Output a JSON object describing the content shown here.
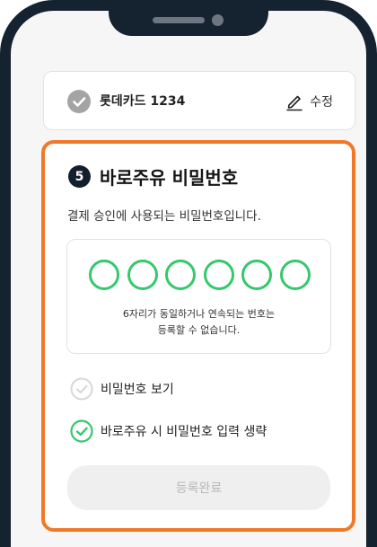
{
  "card": {
    "name": "롯데카드 1234",
    "edit_label": "수정"
  },
  "password_section": {
    "step_number": "5",
    "title": "바로주유 비밀번호",
    "description": "결제 승인에 사용되는 비밀번호입니다.",
    "pin_length": 6,
    "hint_line1": "6자리가 동일하거나 연속되는 번호는",
    "hint_line2": "등록할 수 없습니다.",
    "show_password": {
      "label": "비밀번호 보기",
      "checked": false
    },
    "skip_password": {
      "label": "바로주유 시 비밀번호 입력 생략",
      "checked": true
    },
    "submit_label": "등록완료"
  },
  "colors": {
    "accent_orange": "#f07826",
    "pin_green": "#35c86c",
    "frame_navy": "#152230"
  },
  "icons": {
    "card_check": "check-circle-icon",
    "edit": "pencil-icon",
    "option_unchecked": "check-circle-outline-icon",
    "option_checked": "check-circle-green-icon"
  }
}
